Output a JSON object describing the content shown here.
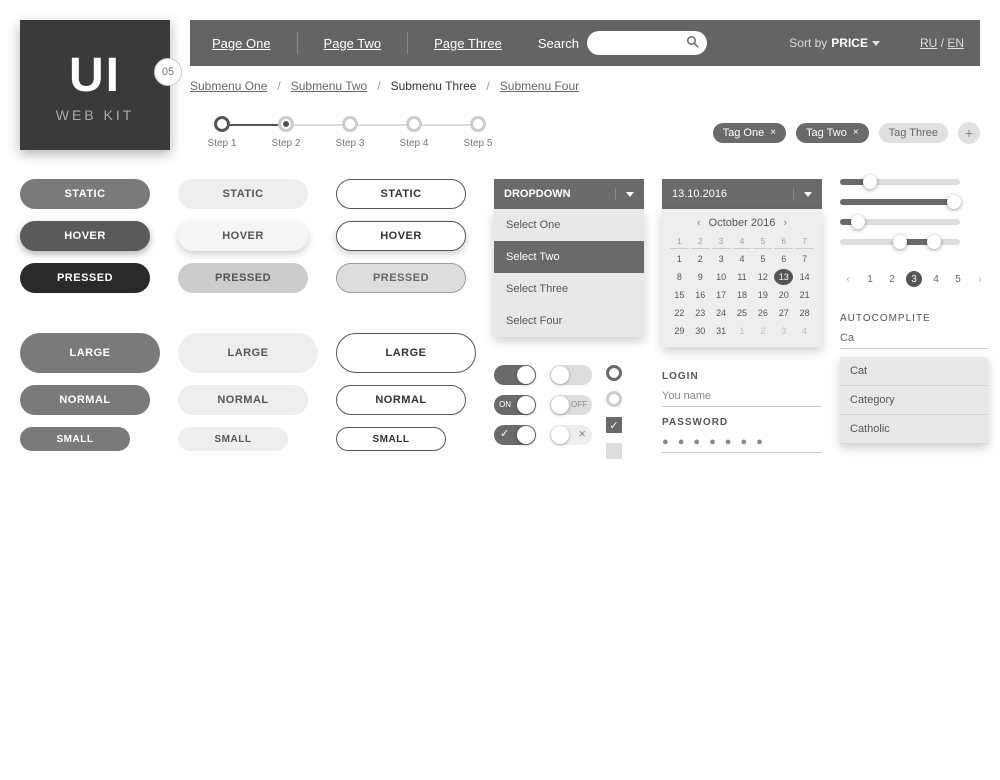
{
  "logo": {
    "title": "UI",
    "subtitle": "WEB KIT",
    "badge": "05"
  },
  "header": {
    "nav": [
      "Page One",
      "Page Two",
      "Page Three"
    ],
    "search_label": "Search",
    "sort_label": "Sort by",
    "sort_value": "PRICE",
    "lang": [
      "RU",
      "EN"
    ]
  },
  "breadcrumb": [
    "Submenu One",
    "Submenu Two",
    "Submenu Three",
    "Submenu Four"
  ],
  "breadcrumb_current_index": 2,
  "steps": [
    "Step 1",
    "Step 2",
    "Step 3",
    "Step 4",
    "Step 5"
  ],
  "tags": [
    {
      "label": "Tag One",
      "style": "dark",
      "closable": true
    },
    {
      "label": "Tag Two",
      "style": "dark",
      "closable": true
    },
    {
      "label": "Tag Three",
      "style": "light",
      "closable": false
    }
  ],
  "buttons": {
    "states": {
      "static": "STATIC",
      "hover": "HOVER",
      "pressed": "PRESSED"
    },
    "sizes": {
      "large": "LARGE",
      "normal": "NORMAL",
      "small": "SMALL"
    }
  },
  "dropdown": {
    "label": "DROPDOWN",
    "items": [
      "Select One",
      "Select Two",
      "Select Three",
      "Select Four"
    ],
    "selected_index": 1
  },
  "toggles": {
    "on_label": "ON",
    "off_label": "OFF"
  },
  "datepicker": {
    "value": "13.10.2016",
    "month_label": "October 2016",
    "dow": [
      "1",
      "2",
      "3",
      "4",
      "5",
      "6",
      "7"
    ],
    "selected_day": 13,
    "days_in_month": 31,
    "trailing": [
      1,
      2,
      3,
      4
    ]
  },
  "login": {
    "login_label": "LOGIN",
    "login_placeholder": "You name",
    "password_label": "PASSWORD",
    "password_mask": "● ● ● ● ● ● ●"
  },
  "sliders": [
    {
      "fill": 25,
      "knobs": [
        25
      ]
    },
    {
      "fill": 95,
      "knobs": [
        95
      ]
    },
    {
      "fill": 15,
      "knobs": [
        15
      ]
    },
    {
      "fill_range": [
        50,
        78
      ],
      "knobs": [
        50,
        78
      ]
    }
  ],
  "pagination": {
    "pages": [
      1,
      2,
      3,
      4,
      5
    ],
    "active": 3
  },
  "autocomplete": {
    "label": "AUTOCOMPLITE",
    "value": "Ca",
    "suggestions": [
      "Cat",
      "Category",
      "Catholic"
    ]
  }
}
